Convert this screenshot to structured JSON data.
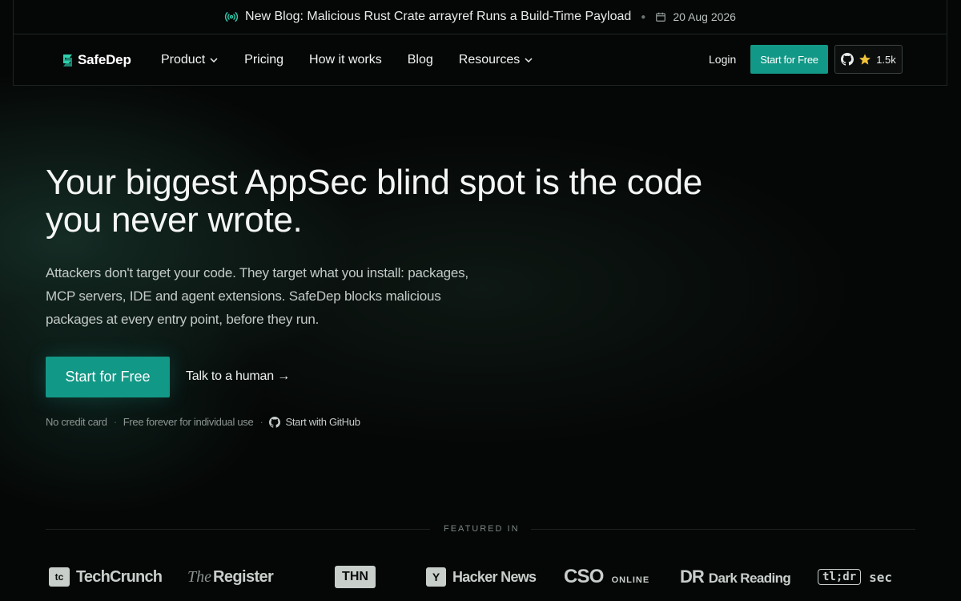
{
  "announcement": {
    "text": "New Blog: Malicious Rust Crate arrayref Runs a Build-Time Payload",
    "date": "20 Aug 2026"
  },
  "nav": {
    "brand": "SafeDep",
    "links": [
      {
        "label": "Product",
        "has_dropdown": true
      },
      {
        "label": "Pricing",
        "has_dropdown": false
      },
      {
        "label": "How it works",
        "has_dropdown": false
      },
      {
        "label": "Blog",
        "has_dropdown": false
      },
      {
        "label": "Resources",
        "has_dropdown": true
      }
    ],
    "login": "Login",
    "cta": "Start for Free",
    "github_stars": "1.5k"
  },
  "hero": {
    "title_line1": "Your biggest AppSec blind spot is the code",
    "title_line2": "you never wrote.",
    "subtitle": "Attackers don't target your code. They target what you install: packages, MCP servers, IDE and agent extensions. SafeDep blocks malicious packages at every entry point, before they run.",
    "cta_primary": "Start for Free",
    "cta_secondary": "Talk to a human →",
    "notes": [
      "No credit card",
      "Free forever for individual use",
      "Start with GitHub"
    ]
  },
  "featured": {
    "label": "FEATURED IN",
    "logos": {
      "techcrunch_mark": "tc",
      "techcrunch": "TechCrunch",
      "register_the": "The",
      "register": "Register",
      "thn": "THN",
      "hn_mark": "Y",
      "hn": "Hacker News",
      "cso": "CSO",
      "cso_online": "ONLINE",
      "dr_mark": "DR",
      "dr": "Dark Reading",
      "tldr_mark": "tl;dr",
      "tldr": "sec"
    }
  },
  "colors": {
    "accent": "#129886",
    "background": "#050706"
  }
}
